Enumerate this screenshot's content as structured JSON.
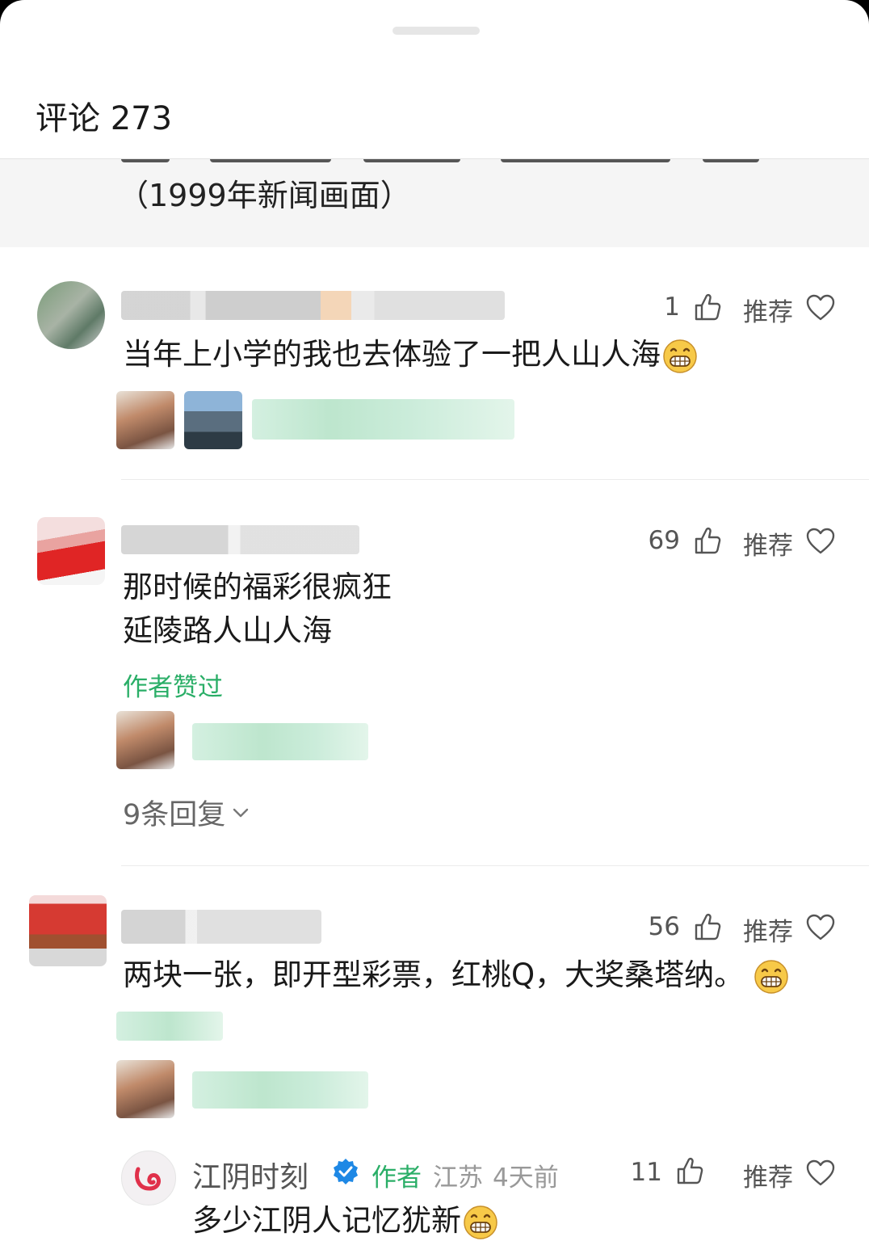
{
  "header": {
    "title": "评论 273"
  },
  "quote": {
    "text": "（1999年新闻画面）"
  },
  "comments": [
    {
      "likes": "1",
      "recommend": "推荐",
      "text": "当年上小学的我也去体验了一把人山人海"
    },
    {
      "likes": "69",
      "recommend": "推荐",
      "text_line1": "那时候的福彩很疯狂",
      "text_line2": "延陵路人山人海",
      "author_liked": "作者赞过",
      "replies": "9条回复"
    },
    {
      "likes": "56",
      "recommend": "推荐",
      "text": "两块一张，即开型彩票，红桃Q，大奖桑塔纳。"
    }
  ],
  "author_reply": {
    "name": "江阴时刻",
    "tag": "作者",
    "location": "江苏",
    "time": "4天前",
    "likes": "11",
    "recommend": "推荐",
    "text": "多少江阴人记忆犹新"
  },
  "colors": {
    "green": "#2aae67",
    "verified": "#1e88e5"
  },
  "icons": [
    "thumbs-up-icon",
    "heart-icon",
    "grin-emoji-icon",
    "chevron-down-icon",
    "verified-badge-icon"
  ]
}
